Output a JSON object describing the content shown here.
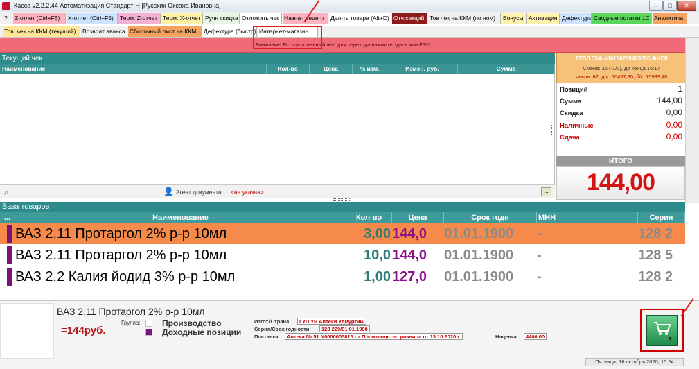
{
  "window": {
    "title": "Касса v2.2.2.44 Автоматизация Стандарт-Н [Русских Оксана Ивановна]",
    "controls": {
      "minimize": "–",
      "maximize": "□",
      "close": "✕"
    }
  },
  "toolbar_row1": [
    {
      "label": "?",
      "bg": "#f0f0f0",
      "color": "#000000"
    },
    {
      "label": "Z-отчет (Ctrl+F6)",
      "bg": "#ffb3c1",
      "color": "#000000"
    },
    {
      "label": "X-отчет (Ctrl+F5)",
      "bg": "#cce4ff",
      "color": "#000000"
    },
    {
      "label": "Терм: Z-отчет",
      "bg": "#f5b0d6",
      "color": "#000000"
    },
    {
      "label": "Терм: X-отчет",
      "bg": "#fff2a8",
      "color": "#000000"
    },
    {
      "label": "Ручн скидка",
      "bg": "#e6f7e6",
      "color": "#000000"
    },
    {
      "label": "Отложить чек",
      "bg": "#ffffff",
      "color": "#000000"
    },
    {
      "label": "Назнач рецепт",
      "bg": "#ffb3c1",
      "color": "#000000"
    },
    {
      "label": "Дел-ть товара (Alt+D)",
      "bg": "#ffffff",
      "color": "#000000"
    },
    {
      "label": "Отч.секций",
      "bg": "#8b1a1a",
      "color": "#ffffff"
    },
    {
      "label": "Тов чек на ККМ (по ном)",
      "bg": "#f0f0f0",
      "color": "#000000"
    },
    {
      "label": "Бонусы",
      "bg": "#fff3b0",
      "color": "#000000"
    },
    {
      "label": "Активация",
      "bg": "#fff3b0",
      "color": "#000000"
    },
    {
      "label": "Дефектура",
      "bg": "#cde4ff",
      "color": "#000000"
    },
    {
      "label": "Сводные остатки 1С",
      "bg": "#5cd65c",
      "color": "#000000"
    },
    {
      "label": "Аналитика",
      "bg": "#f4a460",
      "color": "#000000"
    }
  ],
  "toolbar_row2": [
    {
      "label": "Тов. чек на ККМ (текущий)",
      "bg": "#ffe699",
      "color": "#000000"
    },
    {
      "label": "Возврат аванса",
      "bg": "#f0f0f0",
      "color": "#000000"
    },
    {
      "label": "Сборочный лист на ККМ",
      "bg": "#f4a460",
      "color": "#000000"
    },
    {
      "label": "Дефектура (быстр)",
      "bg": "#ffffff",
      "color": "#000000"
    },
    {
      "label": "Интернет-магазин",
      "bg": "#ffffff",
      "color": "#000000"
    }
  ],
  "alert": {
    "text": "Внимание! Есть отложенный чек, для перехода нажмите здесь или F5!!!"
  },
  "receipt": {
    "title": "Текущий чек",
    "columns": [
      "Наименование",
      "Кол-во",
      "Цена",
      "% изм.",
      "Измен. руб.",
      "Сумма"
    ],
    "agent_label": "Агент документа:",
    "agent_value": "<не указан>",
    "dots_button": "..."
  },
  "fiscal": {
    "line1": "АТОЛ 55Ф #00106208403255 ФИСК",
    "line2": "Смена: 36 (-1/0), до конца 16:17",
    "line3": "Чеков: 62; д/я: 60457,80; б/к: 15939,40"
  },
  "summary": {
    "positions_label": "Позиций",
    "positions_value": "1",
    "sum_label": "Сумма",
    "sum_value": "144,00",
    "discount_label": "Скидка",
    "discount_value": "0,00",
    "cash_label": "Наличные",
    "cash_value": "0,00",
    "change_label": "Сдача",
    "change_value": "0,00"
  },
  "itogo": {
    "label": "ИТОГО",
    "value": "144,00"
  },
  "base": {
    "title": "База товаров",
    "corner": "...",
    "columns": [
      "Наименование",
      "Кол-во",
      "Цена",
      "Срок годн",
      "МНН",
      "Серия"
    ],
    "rows": [
      {
        "name": "ВАЗ 2.11 Протаргол 2% р-р 10мл",
        "qty": "3,00",
        "price": "144,0",
        "exp": "01.01.1900",
        "mnn": "-",
        "series": "128 2",
        "bg": "#f58a4a",
        "selected": true
      },
      {
        "name": "ВАЗ 2.11 Протаргол 2% р-р 10мл",
        "qty": "10,0",
        "price": "144,0",
        "exp": "01.01.1900",
        "mnn": "-",
        "series": "128 5",
        "bg": "#ffffff",
        "selected": false
      },
      {
        "name": "ВАЗ 2.2 Калия йодид 3% р-р 10мл",
        "qty": "1,00",
        "price": "127,0",
        "exp": "01.01.1900",
        "mnn": "-",
        "series": "128 2",
        "bg": "#ffffff",
        "selected": false
      }
    ]
  },
  "details": {
    "name": "ВАЗ 2.11 Протаргол 2% р-р 10мл",
    "price": "=144руб.",
    "group_label": "Группа:",
    "groups": [
      {
        "label": "Производство",
        "color": "#ffffff"
      },
      {
        "label": "Доходные позиции",
        "color": "#7a1277"
      }
    ],
    "maker_label": "Изгот./Страна:",
    "maker_value": "ГУП УР Аптеки Удмуртии/",
    "series_label": "Серия/Срок годности:",
    "series_value": "128 229/01.01.1900",
    "supply_label": "Поставка:",
    "supply_value": "Аптека № 51 N0000005815 от Производство розница от 13.10.2020 г.",
    "markup_label": "Наценка:",
    "markup_value": "4400.00",
    "cart_count": "3",
    "date": "Пятница, 16 октября 2020, 15:54"
  }
}
